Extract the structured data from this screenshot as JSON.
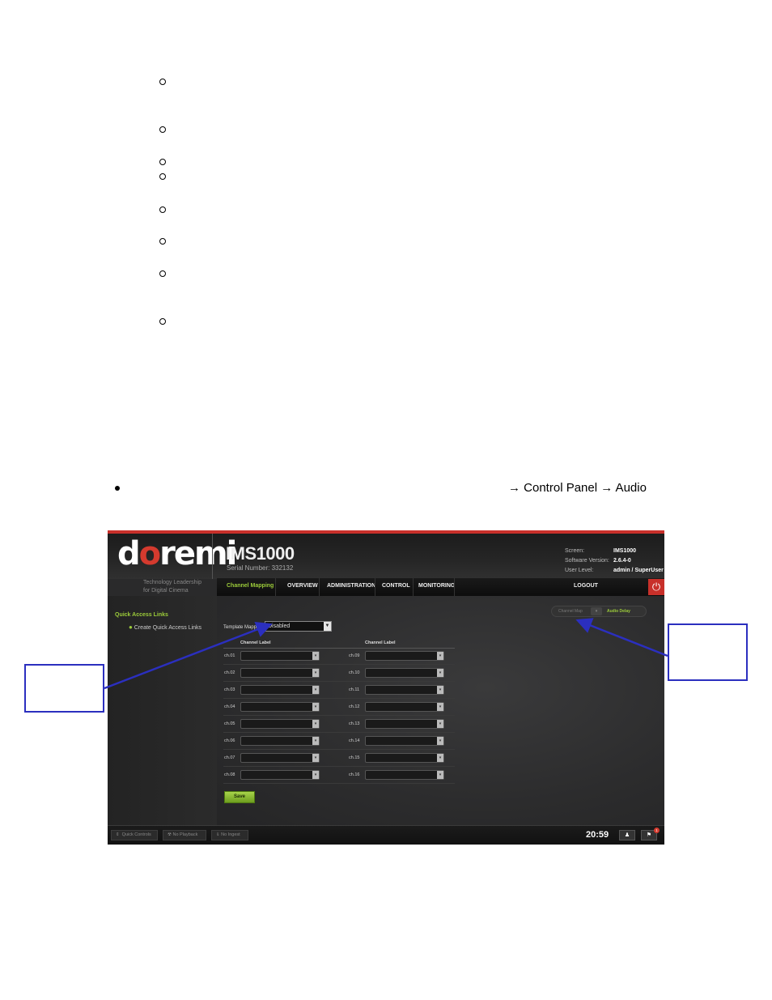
{
  "document": {
    "nav_path": "→ Control Panel → Audio"
  },
  "screenshot": {
    "brand": {
      "logo_pre": "d",
      "logo_o": "o",
      "logo_post": "remi",
      "tagline_line1": "Technology Leadership",
      "tagline_line2": "for Digital Cinema"
    },
    "product": {
      "name": "IMS1000",
      "serial": "Serial Number: 332132"
    },
    "info": {
      "screen_label": "Screen:",
      "screen_value": "IMS1000",
      "software_label": "Software Version:",
      "software_value": "2.6.4-0",
      "user_label": "User Level:",
      "user_value": "admin / SuperUser"
    },
    "nav": {
      "active": "Channel Mapping",
      "overview": "OVERVIEW",
      "administration": "ADMINISTRATION",
      "control": "CONTROL",
      "monitoring": "MONITORING",
      "logout": "LOGOUT"
    },
    "sidebar": {
      "title": "Quick Access Links",
      "link": "Create Quick Access Links"
    },
    "template_mapping": {
      "label": "Template Mapping",
      "value": "Disabled"
    },
    "column_header": "Channel Label",
    "channels_left": [
      "ch.01",
      "ch.02",
      "ch.03",
      "ch.04",
      "ch.05",
      "ch.06",
      "ch.07",
      "ch.08"
    ],
    "channels_right": [
      "ch.09",
      "ch.10",
      "ch.11",
      "ch.12",
      "ch.13",
      "ch.14",
      "ch.15",
      "ch.16"
    ],
    "save_label": "Save",
    "toggle": {
      "left": "Channel Map",
      "right": "Audio Delay"
    },
    "footer": {
      "quick_controls": "Quick Controls",
      "no_playback": "No Playback",
      "no_ingest": "No Ingest",
      "clock": "20:59",
      "badge": "1"
    }
  },
  "colors": {
    "accent_green": "#9ccc3a",
    "brand_red": "#c8302a",
    "annotation_blue": "#2b2fbf"
  }
}
